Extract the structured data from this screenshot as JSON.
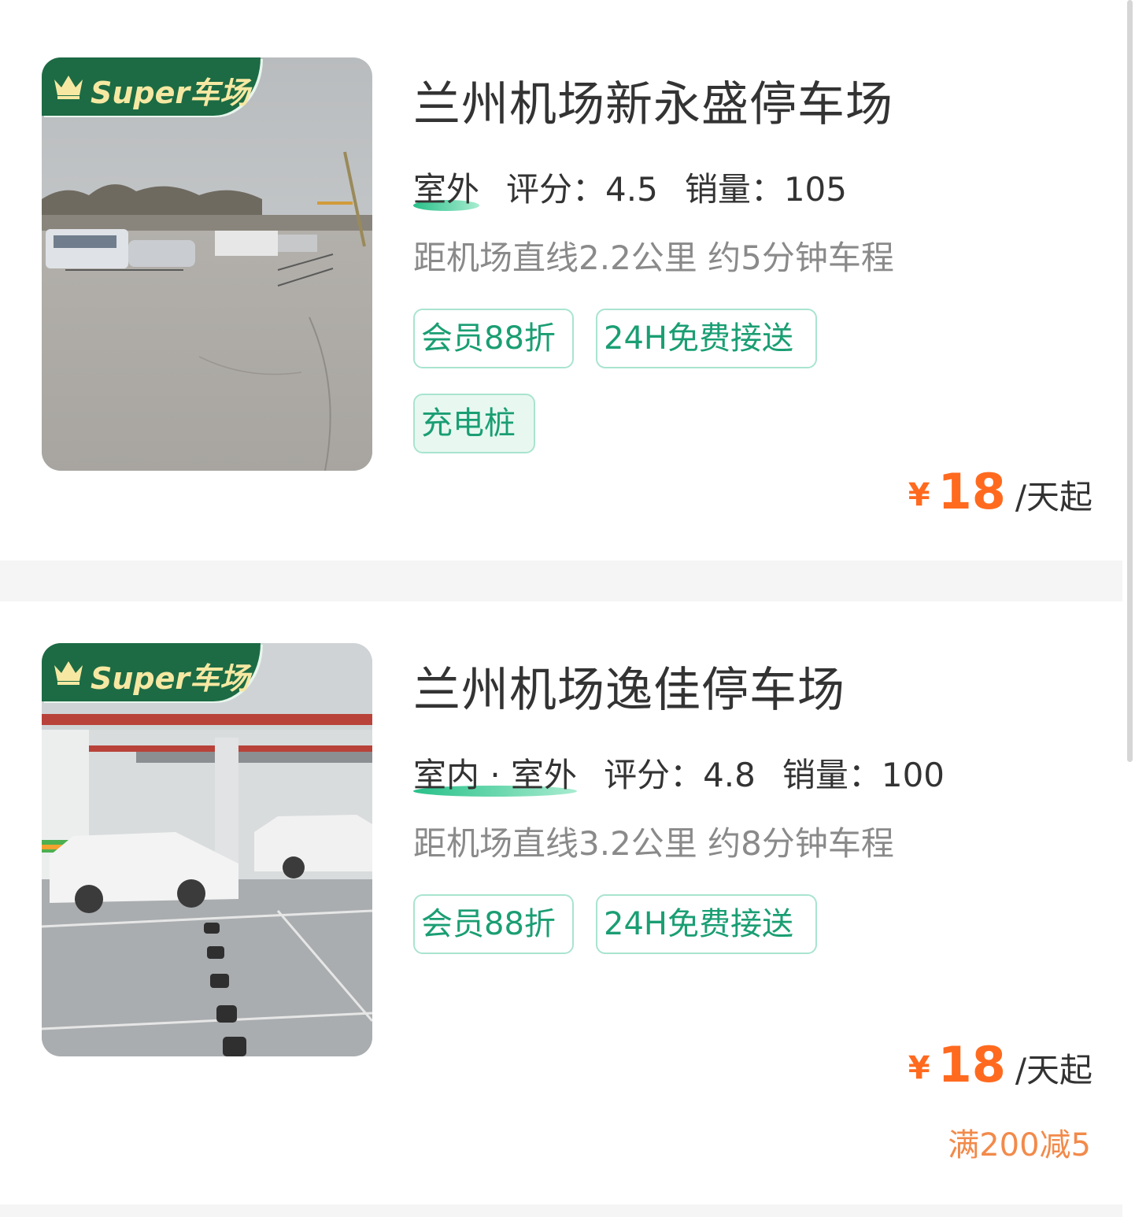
{
  "colors": {
    "brand_green": "#1c6b44",
    "tag_green": "#1a9e73",
    "price_orange": "#ff6a1f",
    "promo_orange": "#f28a4a"
  },
  "lots": [
    {
      "badge": {
        "icon": "crown-icon",
        "text": "Super车场"
      },
      "name": "兰州机场新永盛停车场",
      "type": "室外",
      "rating": "评分：4.5",
      "sales": "销量：105",
      "distance": "距机场直线2.2公里 约5分钟车程",
      "tags": [
        "会员88折",
        "24H免费接送",
        "充电桩"
      ],
      "price": {
        "currency": "¥",
        "amount": "18",
        "unit": "/天起"
      }
    },
    {
      "badge": {
        "icon": "crown-icon",
        "text": "Super车场"
      },
      "name": "兰州机场逸佳停车场",
      "type": "室内 · 室外",
      "rating": "评分：4.8",
      "sales": "销量：100",
      "distance": "距机场直线3.2公里 约8分钟车程",
      "tags": [
        "会员88折",
        "24H免费接送"
      ],
      "price": {
        "currency": "¥",
        "amount": "18",
        "unit": "/天起"
      },
      "promo": "满200减5"
    }
  ]
}
